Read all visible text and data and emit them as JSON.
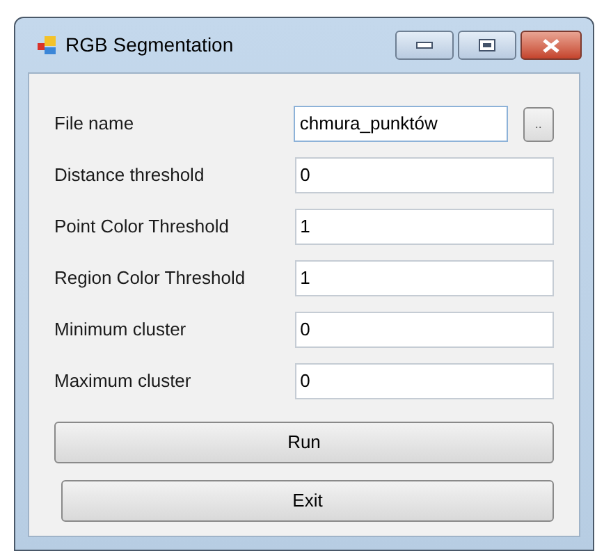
{
  "window": {
    "title": "RGB Segmentation"
  },
  "fields": [
    {
      "kind": "file",
      "label": "File name",
      "value": "chmura_punktów",
      "focused": true,
      "browse": ".."
    },
    {
      "kind": "text",
      "label": "Distance threshold",
      "value": "0",
      "focused": false
    },
    {
      "kind": "text",
      "label": "Point Color Threshold",
      "value": "1",
      "focused": false
    },
    {
      "kind": "text",
      "label": "Region Color Threshold",
      "value": "1",
      "focused": false
    },
    {
      "kind": "text",
      "label": "Minimum cluster",
      "value": "0",
      "focused": false
    },
    {
      "kind": "text",
      "label": "Maximum cluster",
      "value": "0",
      "focused": false
    }
  ],
  "buttons": [
    "Run",
    "Exit"
  ]
}
